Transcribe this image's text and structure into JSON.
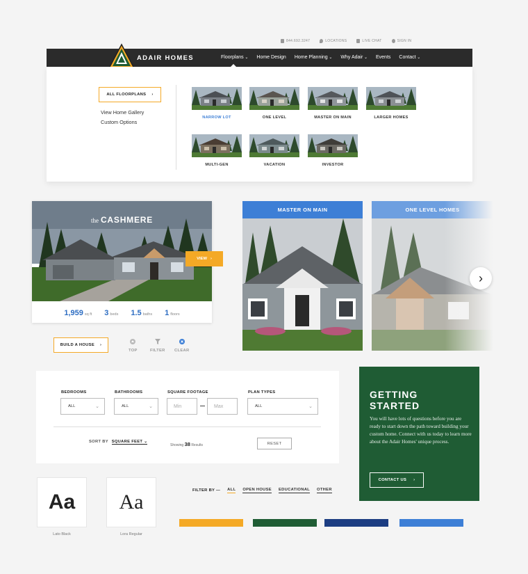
{
  "utility": {
    "phone": "844.692.3247",
    "locations": "LOCATIONS",
    "chat": "LIVE CHAT",
    "signin": "SIGN IN"
  },
  "brand": {
    "name": "ADAIR HOMES"
  },
  "nav": [
    "Floorplans",
    "Home Design",
    "Home Planning",
    "Why Adair",
    "Events",
    "Contact"
  ],
  "mega": {
    "all_label": "ALL FLOORPLANS",
    "links": [
      "View Home Gallery",
      "Custom Options"
    ],
    "tiles": [
      "NARROW LOT",
      "ONE LEVEL",
      "MASTER ON MAIN",
      "LARGER HOMES",
      "MULTI-GEN",
      "VACATION",
      "INVESTOR"
    ]
  },
  "card": {
    "prefix": "the",
    "name": "CASHMERE",
    "view": "VIEW",
    "stats": [
      {
        "value": "1,959",
        "unit": "sq ft"
      },
      {
        "value": "3",
        "unit": "beds"
      },
      {
        "value": "1.5",
        "unit": "baths"
      },
      {
        "value": "1",
        "unit": "floors"
      }
    ]
  },
  "controls": {
    "build": "BUILD A HOUSE",
    "top": "TOP",
    "filter": "FILTER",
    "clear": "CLEAR"
  },
  "carousel": [
    "MASTER ON MAIN",
    "ONE LEVEL HOMES"
  ],
  "filters": {
    "bedrooms": {
      "label": "BEDROOMS",
      "value": "ALL"
    },
    "bathrooms": {
      "label": "BATHROOMS",
      "value": "ALL"
    },
    "sqft": {
      "label": "SQUARE FOOTAGE",
      "min": "Min",
      "max": "Max"
    },
    "plan_types": {
      "label": "PLAN TYPES",
      "value": "ALL"
    },
    "sort_label": "SORT BY",
    "sort_value": "SQUARE FEET",
    "showing_pre": "Showing",
    "showing_count": "38",
    "showing_post": "Results",
    "reset": "RESET"
  },
  "getting_started": {
    "title_1": "GETTING",
    "title_2": "STARTED",
    "body": "You will have lots of questions before you are ready to start down the path toward building your custom home. Connect with us today to learn more about the Adair Homes' unique process.",
    "cta": "CONTACT US"
  },
  "fonts": [
    {
      "sample": "Aa",
      "caption": "Lato Black"
    },
    {
      "sample": "Aa",
      "caption": "Lora Regular"
    }
  ],
  "filter_by": {
    "label": "FILTER BY",
    "tabs": [
      "ALL",
      "OPEN HOUSE",
      "EDUCATIONAL",
      "OTHER"
    ]
  },
  "palette": [
    "#f4a926",
    "#1f5c34",
    "#1c3d82",
    "#3d7fd6"
  ],
  "colors": {
    "accent": "#f4a926",
    "green": "#1f5c34",
    "blue": "#3d7fd6",
    "dark": "#2b2b2b"
  }
}
